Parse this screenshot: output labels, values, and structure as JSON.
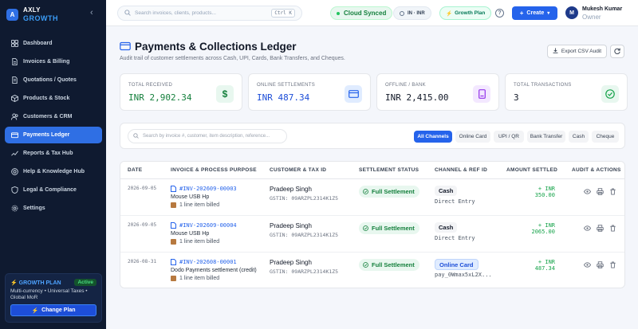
{
  "brand": {
    "line1": "AXLY",
    "line2": "GROWTH",
    "logo_letter": "A"
  },
  "sidebar": {
    "items": [
      {
        "label": "Dashboard",
        "icon": "dashboard-icon"
      },
      {
        "label": "Invoices & Billing",
        "icon": "invoice-icon"
      },
      {
        "label": "Quotations / Quotes",
        "icon": "quote-icon"
      },
      {
        "label": "Products & Stock",
        "icon": "box-icon"
      },
      {
        "label": "Customers & CRM",
        "icon": "users-icon"
      },
      {
        "label": "Payments Ledger",
        "icon": "card-icon",
        "active": true
      },
      {
        "label": "Reports & Tax Hub",
        "icon": "chart-icon"
      },
      {
        "label": "Help & Knowledge Hub",
        "icon": "help-icon"
      },
      {
        "label": "Legal & Compliance",
        "icon": "shield-icon"
      },
      {
        "label": "Settings",
        "icon": "gear-icon"
      }
    ],
    "plan": {
      "title": "GROWTH PLAN",
      "badge": "Active",
      "desc": "Multi-currency • Universal Taxes • Global MoR",
      "button": "Change Plan"
    }
  },
  "topbar": {
    "search_placeholder": "Search invoices, clients, products...",
    "shortcut": "Ctrl K",
    "sync": "Cloud Synced",
    "region": "IN · INR",
    "plan": "Growth Plan",
    "create": "Create",
    "user_initial": "M",
    "user_name": "Mukesh Kumar",
    "user_role": "Owner"
  },
  "header": {
    "title": "Payments & Collections Ledger",
    "subtitle": "Audit trail of customer settlements across Cash, UPI, Cards, Bank Transfers, and Cheques.",
    "export": "Export CSV Audit"
  },
  "stats": [
    {
      "label": "TOTAL RECEIVED",
      "value": "INR 2,902.34",
      "color": "#15803d",
      "icon": "dollar-icon"
    },
    {
      "label": "ONLINE SETTLEMENTS",
      "value": "INR 487.34",
      "color": "#1d4ed8",
      "icon": "card-icon"
    },
    {
      "label": "OFFLINE / BANK",
      "value": "INR 2,415.00",
      "color": "#111827",
      "icon": "wallet-icon"
    },
    {
      "label": "TOTAL TRANSACTIONS",
      "value": "3",
      "color": "#111827",
      "icon": "check-circle-icon"
    }
  ],
  "filters": {
    "search_placeholder": "Search by invoice #, customer, item description, reference...",
    "chips": [
      "All Channels",
      "Online Card",
      "UPI / QR",
      "Bank Transfer",
      "Cash",
      "Cheque"
    ],
    "active": "All Channels"
  },
  "table": {
    "columns": [
      "DATE",
      "INVOICE & PROCESS PURPOSE",
      "CUSTOMER & TAX ID",
      "SETTLEMENT STATUS",
      "CHANNEL & REF ID",
      "AMOUNT SETTLED",
      "AUDIT & ACTIONS"
    ],
    "rows": [
      {
        "date": "2026-09-05",
        "invoice": "#INV-202609-00003",
        "desc": "Mouse USB Hp",
        "billed": "1 line item billed",
        "customer": "Pradeep Singh",
        "gstin": "GSTIN: 09ARZPL2314K1Z5",
        "status": "Full Settlement",
        "channel": "Cash",
        "ref": "Direct Entry",
        "amount": "+ INR 350.00"
      },
      {
        "date": "2026-09-05",
        "invoice": "#INV-202609-00004",
        "desc": "Mouse USB Hp",
        "billed": "1 line item billed",
        "customer": "Pradeep Singh",
        "gstin": "GSTIN: 09ARZPL2314K1Z5",
        "status": "Full Settlement",
        "channel": "Cash",
        "ref": "Direct Entry",
        "amount": "+ INR 2065.00"
      },
      {
        "date": "2026-08-31",
        "invoice": "#INV-202608-00001",
        "desc": "Dodo Payments settlement (credit)",
        "billed": "1 line item billed",
        "customer": "Pradeep Singh",
        "gstin": "GSTIN: 09ARZPL2314K1Z5",
        "status": "Full Settlement",
        "channel": "Online Card",
        "ref": "pay_0Wmax5xL2X...",
        "amount": "+ INR 487.34"
      }
    ]
  }
}
